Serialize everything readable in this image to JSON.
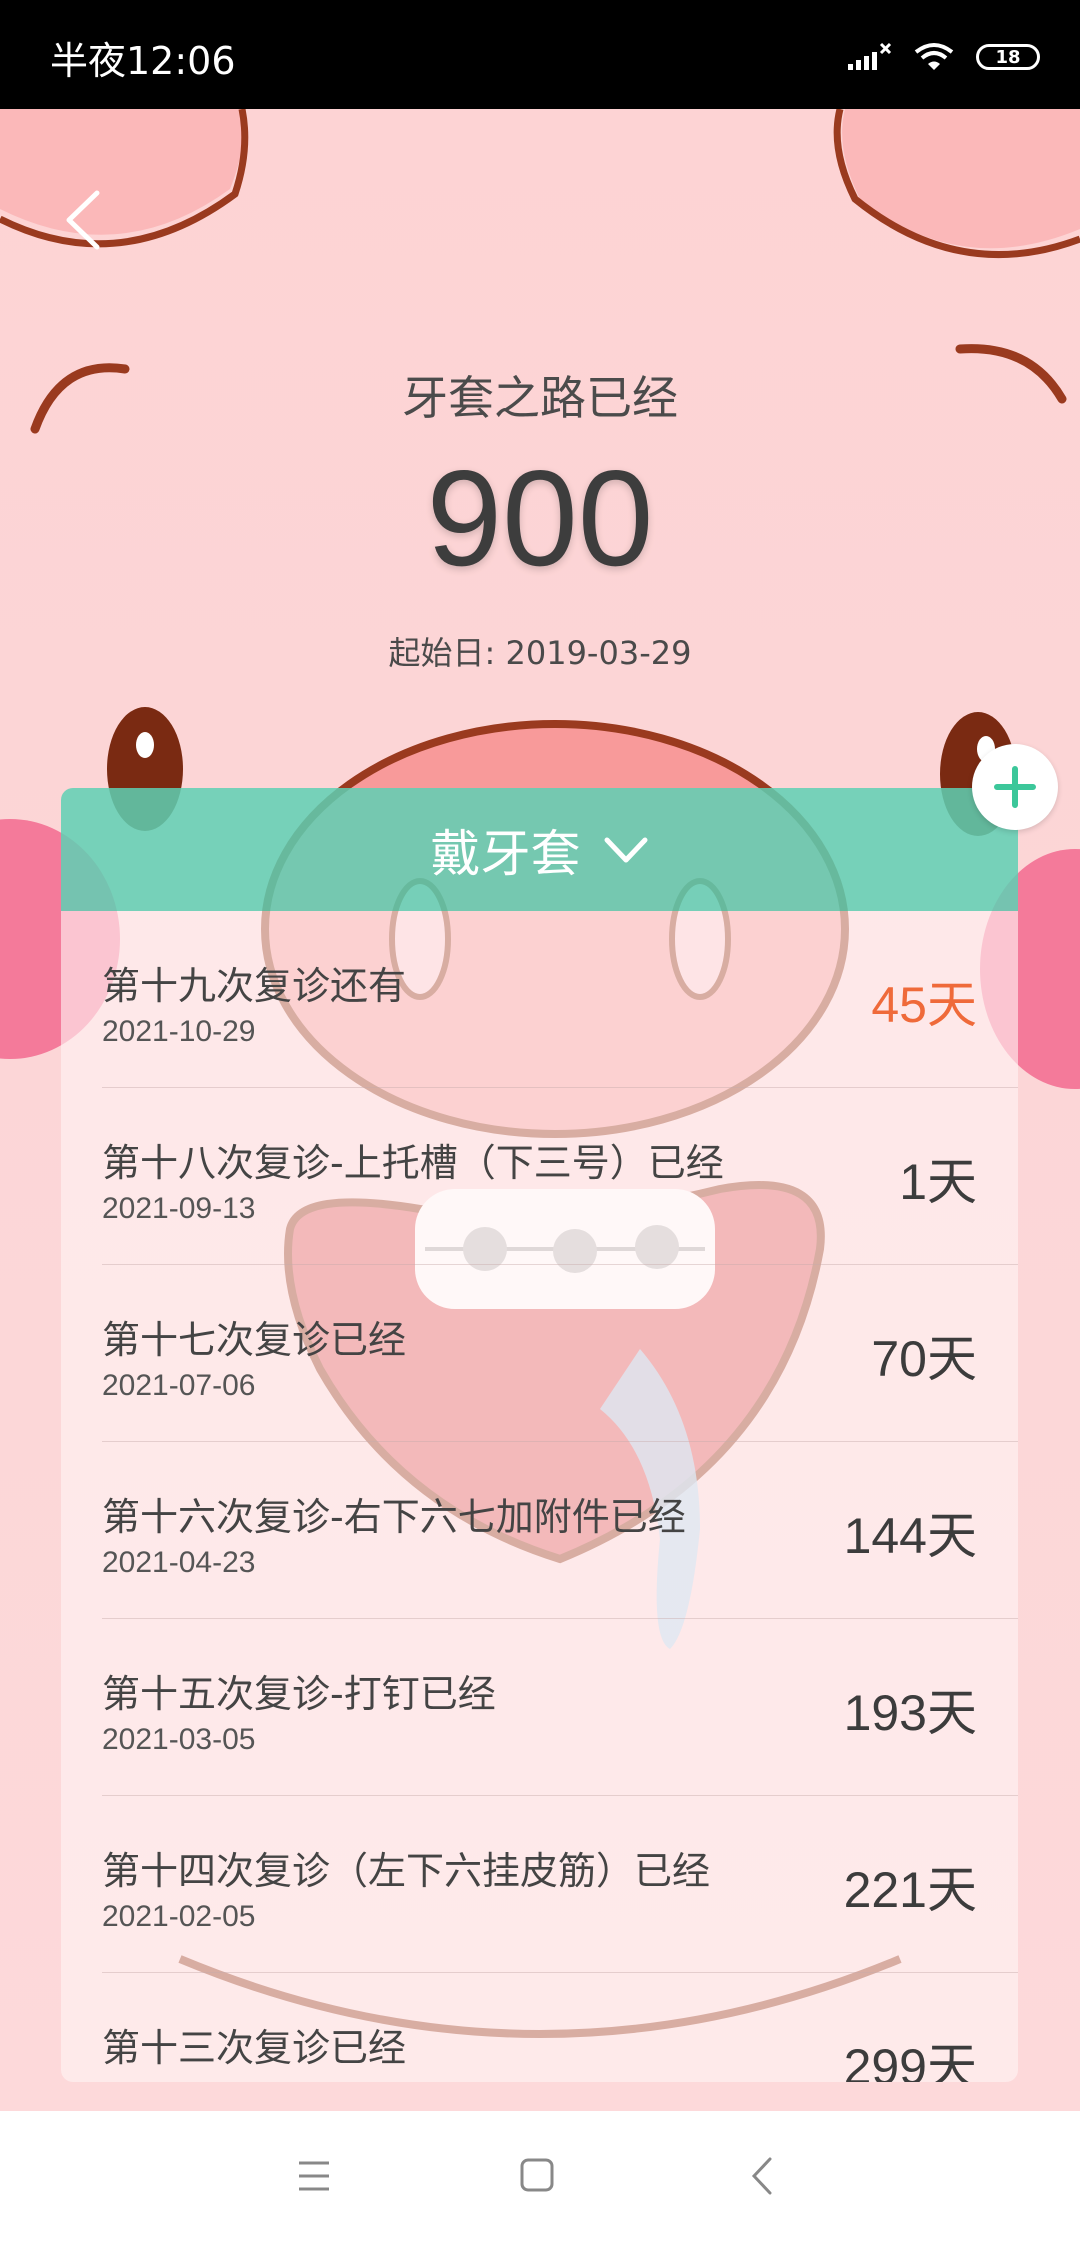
{
  "status_bar": {
    "time": "半夜12:06",
    "battery": "18",
    "icons": [
      "signal-icon",
      "wifi-icon",
      "battery-icon"
    ]
  },
  "header": {
    "title": "牙套之路已经",
    "days": "900",
    "start_date": "起始日: 2019-03-29"
  },
  "panel": {
    "mode": "戴牙套",
    "rows": [
      {
        "label": "第十九次复诊还有",
        "date": "2021-10-29",
        "days": "45天"
      },
      {
        "label": "第十八次复诊-上托槽（下三号）已经",
        "date": "2021-09-13",
        "days": "1天"
      },
      {
        "label": "第十七次复诊已经",
        "date": "2021-07-06",
        "days": "70天"
      },
      {
        "label": "第十六次复诊-右下六七加附件已经",
        "date": "2021-04-23",
        "days": "144天"
      },
      {
        "label": "第十五次复诊-打钉已经",
        "date": "2021-03-05",
        "days": "193天"
      },
      {
        "label": "第十四次复诊（左下六挂皮筋）已经",
        "date": "2021-02-05",
        "days": "221天"
      },
      {
        "label": "第十三次复诊已经",
        "date": "",
        "days": "299天"
      }
    ]
  },
  "colors": {
    "accent_teal": "#5ed0b4",
    "accent_orange": "#ef6a3a",
    "background_pink": "#fdd7d7"
  }
}
